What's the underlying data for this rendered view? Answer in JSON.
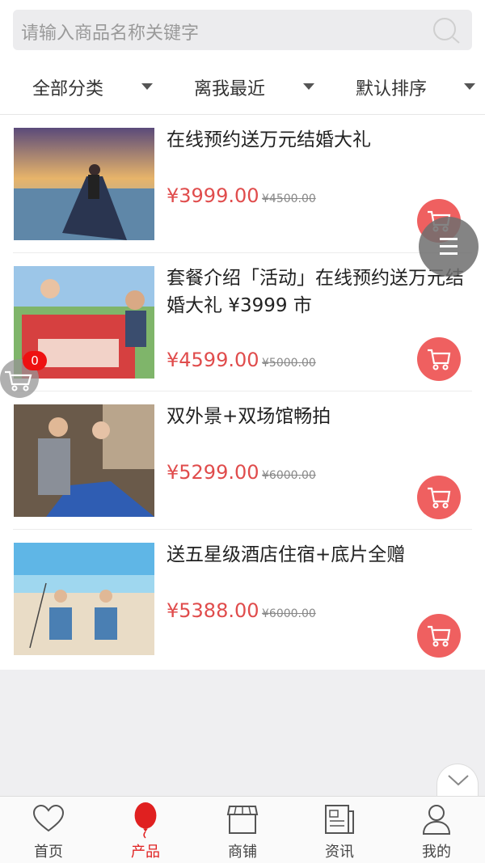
{
  "search": {
    "placeholder": "请输入商品名称关键字"
  },
  "filters": [
    {
      "label": "全部分类"
    },
    {
      "label": "离我最近"
    },
    {
      "label": "默认排序"
    }
  ],
  "products": [
    {
      "title": "在线预约送万元结婚大礼",
      "price": "¥3999.00",
      "old_price": "¥4500.00"
    },
    {
      "title": "套餐介绍「活动」在线预约送万元结婚大礼 ¥3999 市",
      "price": "¥4599.00",
      "old_price": "¥5000.00"
    },
    {
      "title": "双外景+双场馆畅拍",
      "price": "¥5299.00",
      "old_price": "¥6000.00"
    },
    {
      "title": "送五星级酒店住宿+底片全赠",
      "price": "¥5388.00",
      "old_price": "¥6000.00"
    }
  ],
  "cart": {
    "count": "0"
  },
  "tabs": [
    {
      "label": "首页",
      "icon": "heart-icon"
    },
    {
      "label": "产品",
      "icon": "balloon-icon",
      "active": true
    },
    {
      "label": "商铺",
      "icon": "shop-icon"
    },
    {
      "label": "资讯",
      "icon": "news-icon"
    },
    {
      "label": "我的",
      "icon": "user-icon"
    }
  ],
  "colors": {
    "price": "#e04c4c",
    "cart_button": "#ef6060",
    "active_tab": "#e02020",
    "badge": "#ee1111"
  }
}
